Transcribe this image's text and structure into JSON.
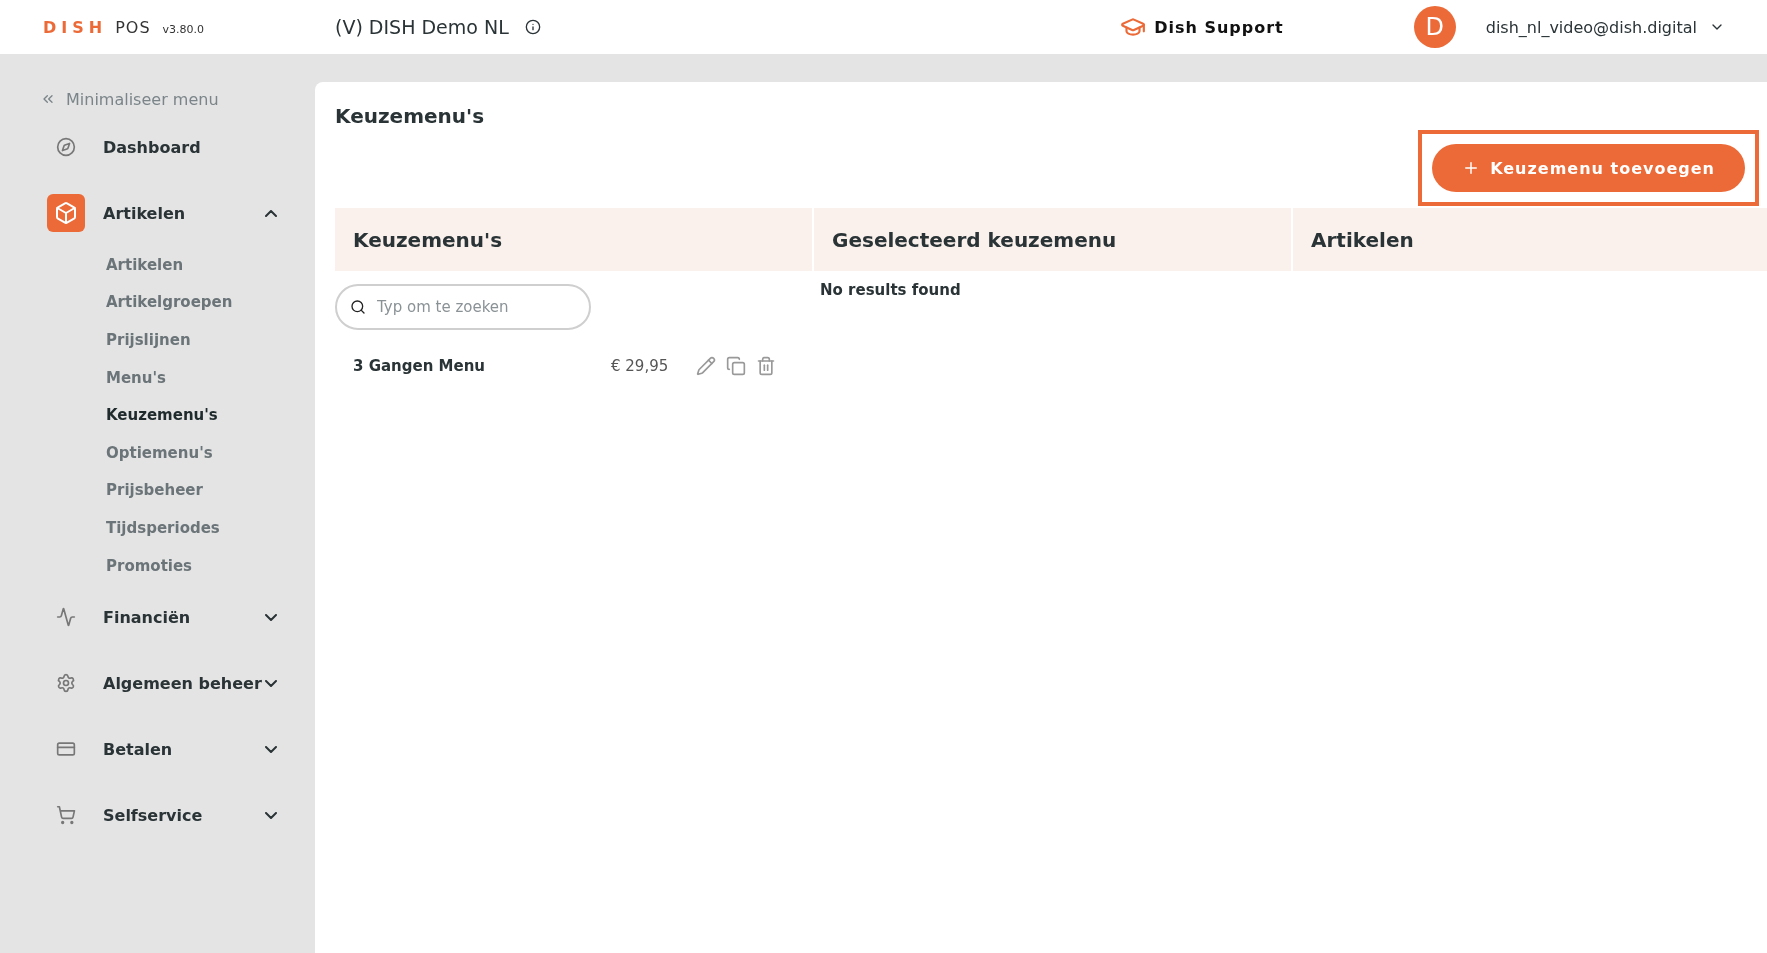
{
  "header": {
    "logo_brand": "DISH",
    "logo_product": "POS",
    "version": "v3.80.0",
    "venue": "(V) DISH Demo NL",
    "support": "Dish Support",
    "avatar_letter": "D",
    "account": "dish_nl_video@dish.digital"
  },
  "sidebar": {
    "collapse_label": "Minimaliseer menu",
    "items": [
      {
        "label": "Dashboard",
        "active": false
      },
      {
        "label": "Artikelen",
        "expanded": true,
        "active": true,
        "children": [
          {
            "label": "Artikelen",
            "selected": false
          },
          {
            "label": "Artikelgroepen",
            "selected": false
          },
          {
            "label": "Prijslijnen",
            "selected": false
          },
          {
            "label": "Menu's",
            "selected": false
          },
          {
            "label": "Keuzemenu's",
            "selected": true
          },
          {
            "label": "Optiemenu's",
            "selected": false
          },
          {
            "label": "Prijsbeheer",
            "selected": false
          },
          {
            "label": "Tijdsperiodes",
            "selected": false
          },
          {
            "label": "Promoties",
            "selected": false
          }
        ]
      },
      {
        "label": "Financiën",
        "expanded": false,
        "active": false
      },
      {
        "label": "Algemeen beheer",
        "expanded": false,
        "active": false
      },
      {
        "label": "Betalen",
        "expanded": false,
        "active": false
      },
      {
        "label": "Selfservice",
        "expanded": false,
        "active": false
      }
    ]
  },
  "page": {
    "title": "Keuzemenu's",
    "add_button": {
      "label": "Keuzemenu toevoegen",
      "highlighted": true
    },
    "columns": [
      "Keuzemenu's",
      "Geselecteerd keuzemenu",
      "Artikelen"
    ],
    "search": {
      "placeholder": "Typ om te zoeken"
    },
    "menus": [
      {
        "name": "3 Gangen Menu",
        "price": "€ 29,95"
      }
    ],
    "selected_message": "No results found"
  }
}
